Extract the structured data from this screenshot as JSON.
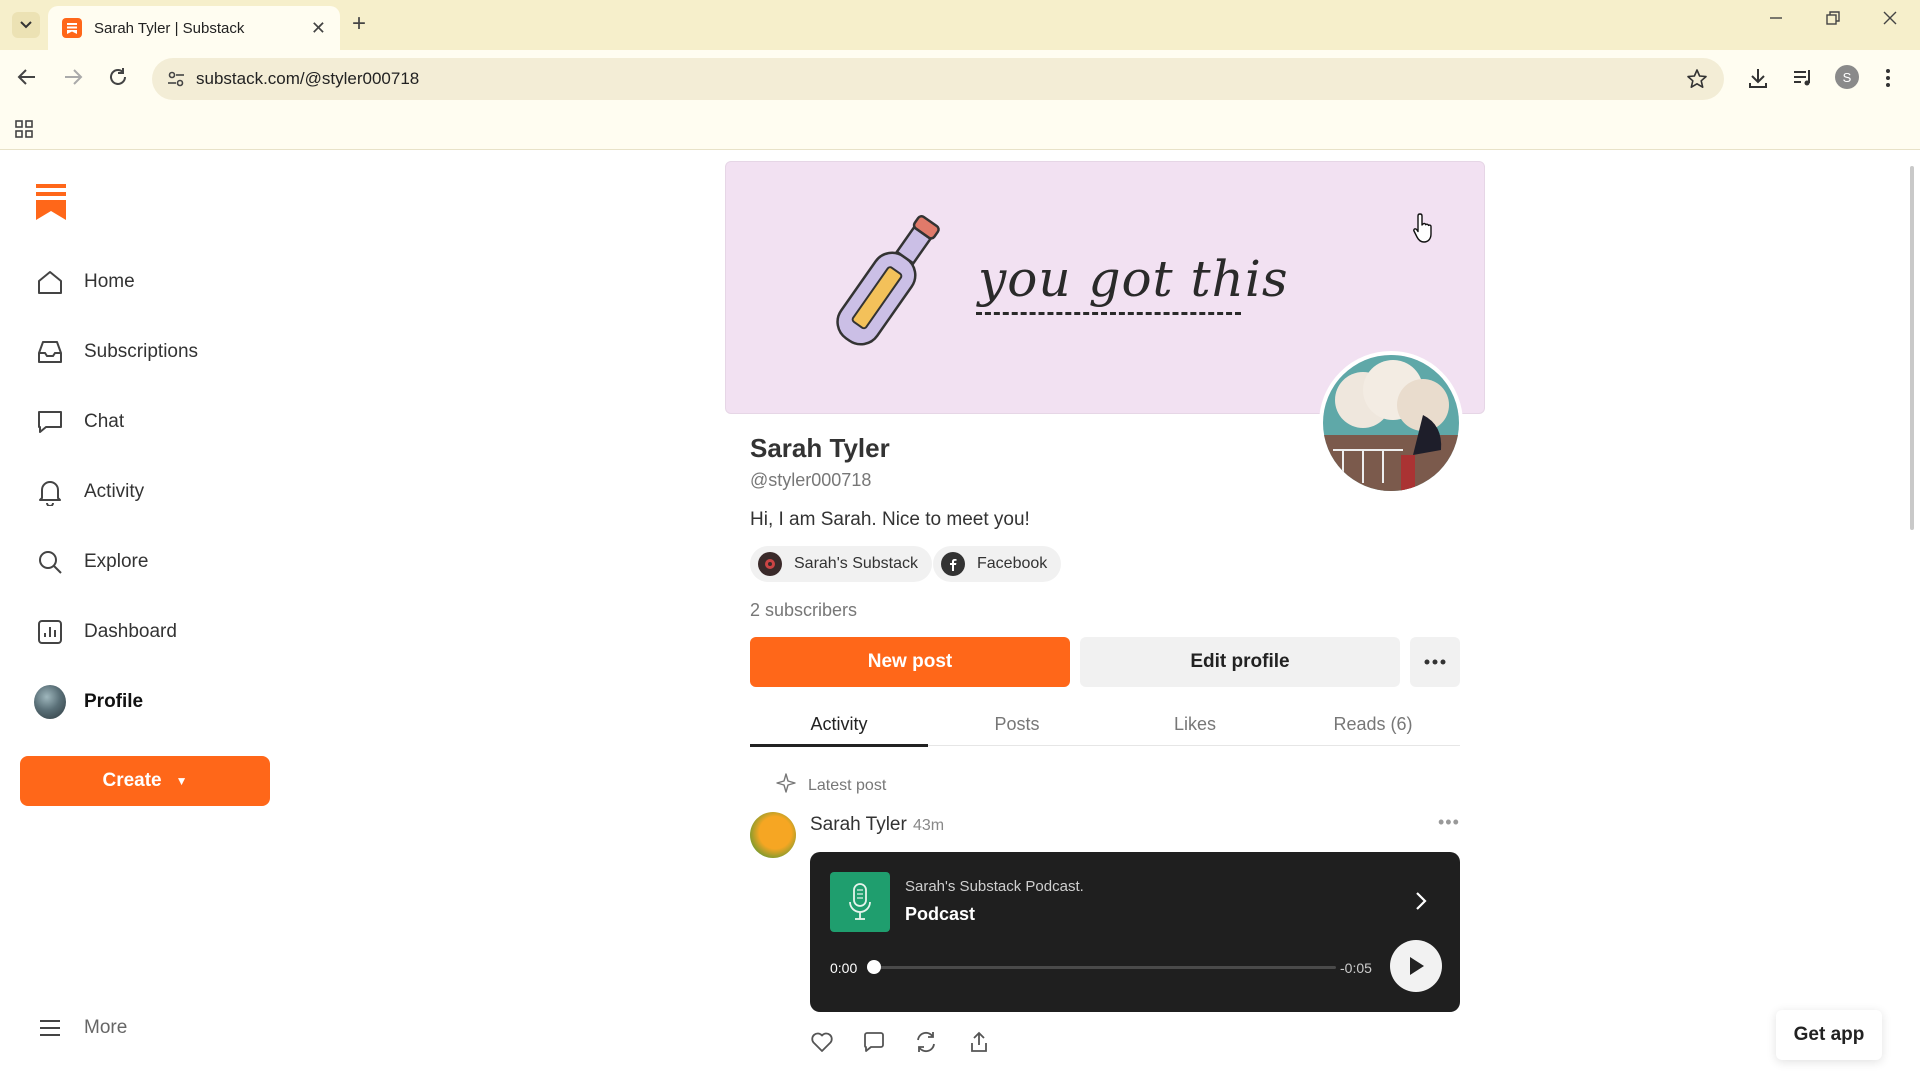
{
  "browser": {
    "tab_title": "Sarah Tyler | Substack",
    "url": "substack.com/@styler000718",
    "profile_initial": "S",
    "accent": "#ff6719"
  },
  "sidebar": {
    "items": [
      {
        "label": "Home",
        "icon": "home-icon"
      },
      {
        "label": "Subscriptions",
        "icon": "inbox-icon"
      },
      {
        "label": "Chat",
        "icon": "chat-icon"
      },
      {
        "label": "Activity",
        "icon": "bell-icon"
      },
      {
        "label": "Explore",
        "icon": "search-icon"
      },
      {
        "label": "Dashboard",
        "icon": "chart-icon"
      },
      {
        "label": "Profile",
        "icon": "avatar"
      }
    ],
    "create_label": "Create",
    "more_label": "More"
  },
  "profile": {
    "banner_text": "you got this",
    "name": "Sarah Tyler",
    "handle": "@styler000718",
    "bio": "Hi, I am Sarah. Nice to meet you!",
    "links": [
      {
        "label": "Sarah's Substack",
        "icon": "substack-publication-icon"
      },
      {
        "label": "Facebook",
        "icon": "facebook-icon"
      }
    ],
    "subscribers": "2 subscribers",
    "new_post_label": "New post",
    "edit_profile_label": "Edit profile"
  },
  "tabs": [
    {
      "label": "Activity",
      "active": true
    },
    {
      "label": "Posts",
      "active": false
    },
    {
      "label": "Likes",
      "active": false
    },
    {
      "label": "Reads (6)",
      "active": false
    }
  ],
  "feed": {
    "section_label": "Latest post",
    "post": {
      "author": "Sarah Tyler",
      "time": "43m",
      "podcast": {
        "publication": "Sarah's Substack Podcast.",
        "title": "Podcast",
        "current_time": "0:00",
        "remaining_time": "-0:05",
        "progress": 0
      }
    }
  },
  "get_app_label": "Get app"
}
